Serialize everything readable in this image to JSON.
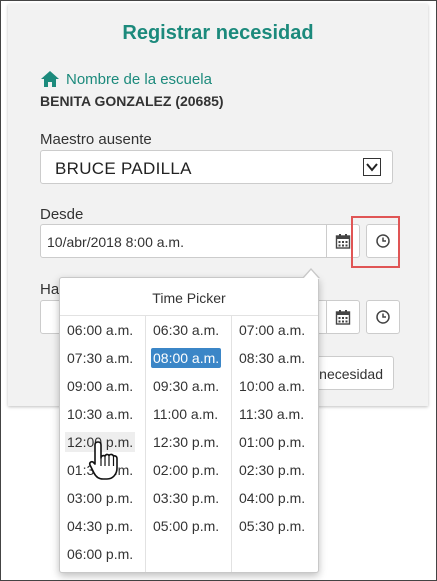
{
  "form": {
    "title": "Registrar necesidad",
    "school_label": "Nombre de la escuela",
    "school_name": "BENITA GONZALEZ (20685)",
    "absent_teacher_label": "Maestro ausente",
    "absent_teacher_value": "BRUCE PADILLA",
    "from_label": "Desde",
    "from_value": "10/abr/2018 8:00 a.m.",
    "to_label_partial": "Ha",
    "submit_partial": "necesidad"
  },
  "time_picker": {
    "title": "Time Picker",
    "selected": "08:00 a.m.",
    "hovered": "12:00 p.m.",
    "columns": [
      [
        "06:00 a.m.",
        "07:30 a.m.",
        "09:00 a.m.",
        "10:30 a.m.",
        "12:00 p.m.",
        "01:30 p.m.",
        "03:00 p.m.",
        "04:30 p.m.",
        "06:00 p.m."
      ],
      [
        "06:30 a.m.",
        "08:00 a.m.",
        "09:30 a.m.",
        "11:00 a.m.",
        "12:30 p.m.",
        "02:00 p.m.",
        "03:30 p.m.",
        "05:00 p.m."
      ],
      [
        "07:00 a.m.",
        "08:30 a.m.",
        "10:00 a.m.",
        "11:30 a.m.",
        "01:00 p.m.",
        "02:30 p.m.",
        "04:00 p.m.",
        "05:30 p.m."
      ]
    ]
  },
  "icons": {
    "home": "home-icon",
    "dropdown": "chevron-down-icon",
    "calendar": "calendar-icon",
    "clock": "clock-icon",
    "cursor": "hand-pointer-icon"
  },
  "colors": {
    "accent": "#1c8a7c",
    "selected": "#3b86c7",
    "highlight": "#e05555"
  }
}
